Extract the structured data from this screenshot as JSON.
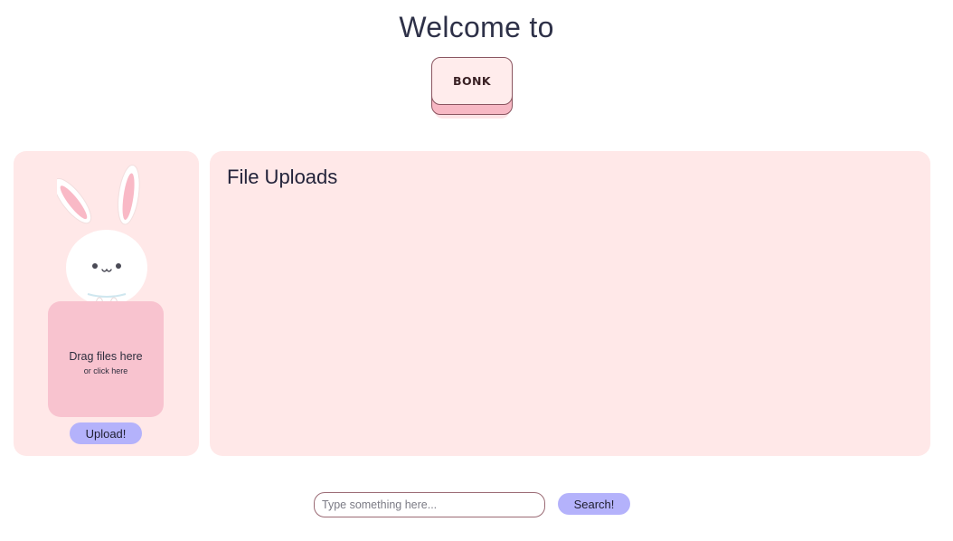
{
  "header": {
    "welcome_text": "Welcome to",
    "brand_button_label": "BONK"
  },
  "upload_panel": {
    "mascot_icon": "bunny-icon",
    "drop_zone": {
      "title": "Drag files here",
      "subtitle": "or click here"
    },
    "upload_button_label": "Upload!"
  },
  "files_panel": {
    "title": "File Uploads",
    "files": []
  },
  "search": {
    "placeholder": "Type something here...",
    "value": "",
    "button_label": "Search!"
  },
  "colors": {
    "panel_background": "#ffe8e8",
    "drop_zone": "#f8c3cf",
    "button_accent": "#b4b2fb",
    "brand_button_face": "#ffecec",
    "brand_button_base": "#f7b8c4"
  }
}
